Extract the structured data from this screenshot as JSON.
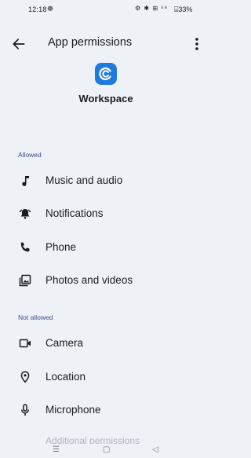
{
  "status_bar": {
    "time": "12:18",
    "left_icons": "☸",
    "right_icons": "⚙ ✱ ⊞ ⁵⁸",
    "battery": "⌸33%"
  },
  "app_bar": {
    "title": "App permissions"
  },
  "app": {
    "name": "Workspace",
    "icon_color": "#1f7ae0"
  },
  "sections": {
    "allowed": {
      "header": "Allowed",
      "items": [
        {
          "label": "Music and audio",
          "icon": "music-note-icon"
        },
        {
          "label": "Notifications",
          "icon": "bell-icon"
        },
        {
          "label": "Phone",
          "icon": "phone-icon"
        },
        {
          "label": "Photos and videos",
          "icon": "photos-icon"
        }
      ]
    },
    "not_allowed": {
      "header": "Not allowed",
      "items": [
        {
          "label": "Camera",
          "icon": "camera-icon"
        },
        {
          "label": "Location",
          "icon": "location-pin-icon"
        },
        {
          "label": "Microphone",
          "icon": "microphone-icon"
        }
      ]
    }
  },
  "partial_row_text": "Additional permissions",
  "nav": {
    "recent": "☰",
    "home": "▢",
    "back": "◁"
  }
}
